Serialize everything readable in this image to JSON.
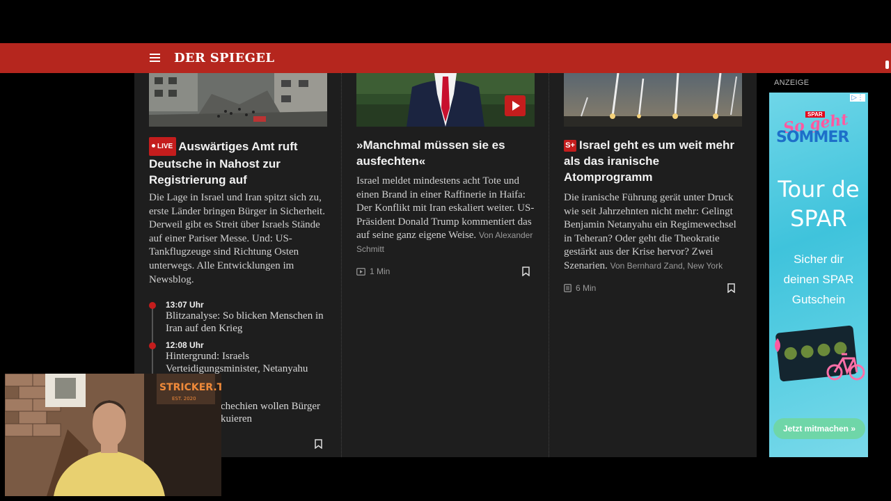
{
  "header": {
    "logo": "DER SPIEGEL"
  },
  "articles": [
    {
      "badge": "LIVE",
      "headline": "Auswärtiges Amt ruft Deutsche in Nahost zur Registrierung auf",
      "teaser": "Die Lage in Israel und Iran spitzt sich zu, erste Länder bringen Bürger in Sicherheit. Derweil gibt es Streit über Israels Stände auf einer Pariser Messe. Und: US-Tankflugzeuge sind Richtung Osten unterwegs. Alle Entwicklungen im Newsblog.",
      "timeline": [
        {
          "time": "13:07 Uhr",
          "text": "Blitzanalyse: So blicken Menschen in Iran auf den Krieg"
        },
        {
          "time": "12:08 Uhr",
          "text": "Hintergrund: Israels Verteidigungsminister, Netanyahu"
        },
        {
          "time": "",
          "text": "chechien wollen Bürger kuieren"
        }
      ]
    },
    {
      "headline": "»Manchmal müssen sie es ausfechten«",
      "teaser": "Israel meldet mindestens acht Tote und einen Brand in einer Raffinerie in Haifa: Der Konflikt mit Iran eskaliert weiter. US-Präsident Donald Trump kommentiert das auf seine ganz eigene Weise.",
      "byline": "Von Alexander Schmitt",
      "duration": "1 Min"
    },
    {
      "badge": "S+",
      "headline": "Israel geht es um weit mehr als das iranische Atomprogramm",
      "teaser": "Die iranische Führung gerät unter Druck wie seit Jahrzehnten nicht mehr: Gelingt Benjamin Netanyahu ein Regimewechsel in Teheran? Oder geht die Theokratie gestärkt aus der Krise hervor? Zwei Szenarien.",
      "byline": "Von Bernhard Zand, New York",
      "duration": "6 Min"
    }
  ],
  "ad": {
    "label": "ANZEIGE",
    "brand_small": "SPAR",
    "line1": "So geht",
    "line2": "SOMMER",
    "tour_line1": "Tour de",
    "tour_line2": "SPAR",
    "sub1": "Sicher dir",
    "sub2": "deinen SPAR",
    "sub3": "Gutschein",
    "cta": "Jetzt mitmachen »"
  },
  "webcam": {
    "sign": "STRICKER.TV",
    "sign_sub": "EST. 2020"
  },
  "colors": {
    "brand_red": "#b5261e",
    "badge_red": "#c41d1d",
    "panel": "#1e1e1e"
  }
}
